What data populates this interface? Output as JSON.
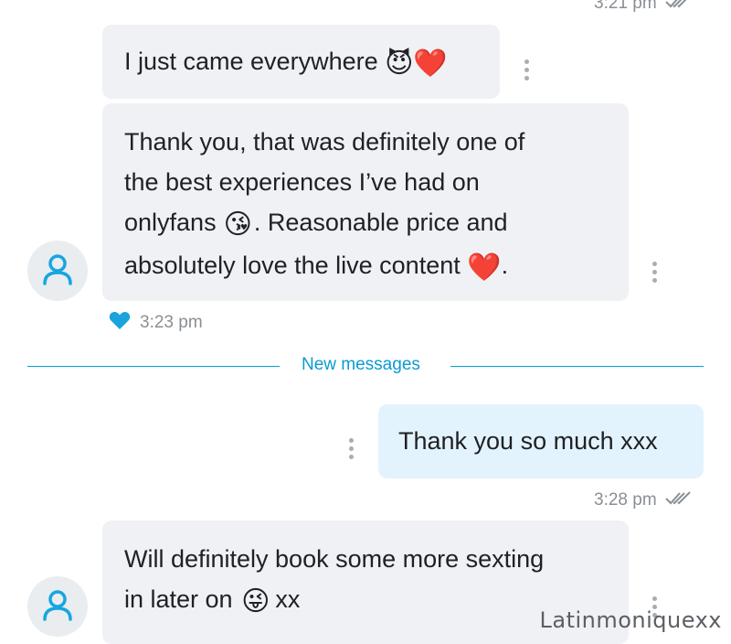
{
  "messages": [
    {
      "text": "I just came everywhere",
      "emoji": "😈❤️",
      "direction": "incoming"
    },
    {
      "text_parts": [
        "Thank you, that was definitely one of",
        "the best experiences I’ve had on",
        "onlyfans",
        ". Reasonable price and",
        "absolutely love the live content",
        "."
      ],
      "emoji_kiss": "😘",
      "emoji_heart": "❤️",
      "direction": "incoming",
      "time": "3:23 pm",
      "reaction": "heart"
    },
    {
      "text": "Thank you so much xxx",
      "direction": "outgoing",
      "time": "3:28 pm",
      "status": "read"
    },
    {
      "text_parts": [
        "Will definitely book some more sexting",
        "in later on",
        "xx"
      ],
      "emoji": "😜",
      "direction": "incoming"
    }
  ],
  "top_time": "3:21 pm",
  "divider_label": "New messages",
  "watermark": "Latinmoniquexx",
  "colors": {
    "incoming_bubble": "#eff1f4",
    "outgoing_bubble": "#e3f3fd",
    "accent": "#00a1d6",
    "heart_reaction": "#1aa3dd"
  },
  "icons": [
    "more-vert-icon",
    "read-check-icon",
    "heart-reaction-icon",
    "user-avatar-icon"
  ]
}
